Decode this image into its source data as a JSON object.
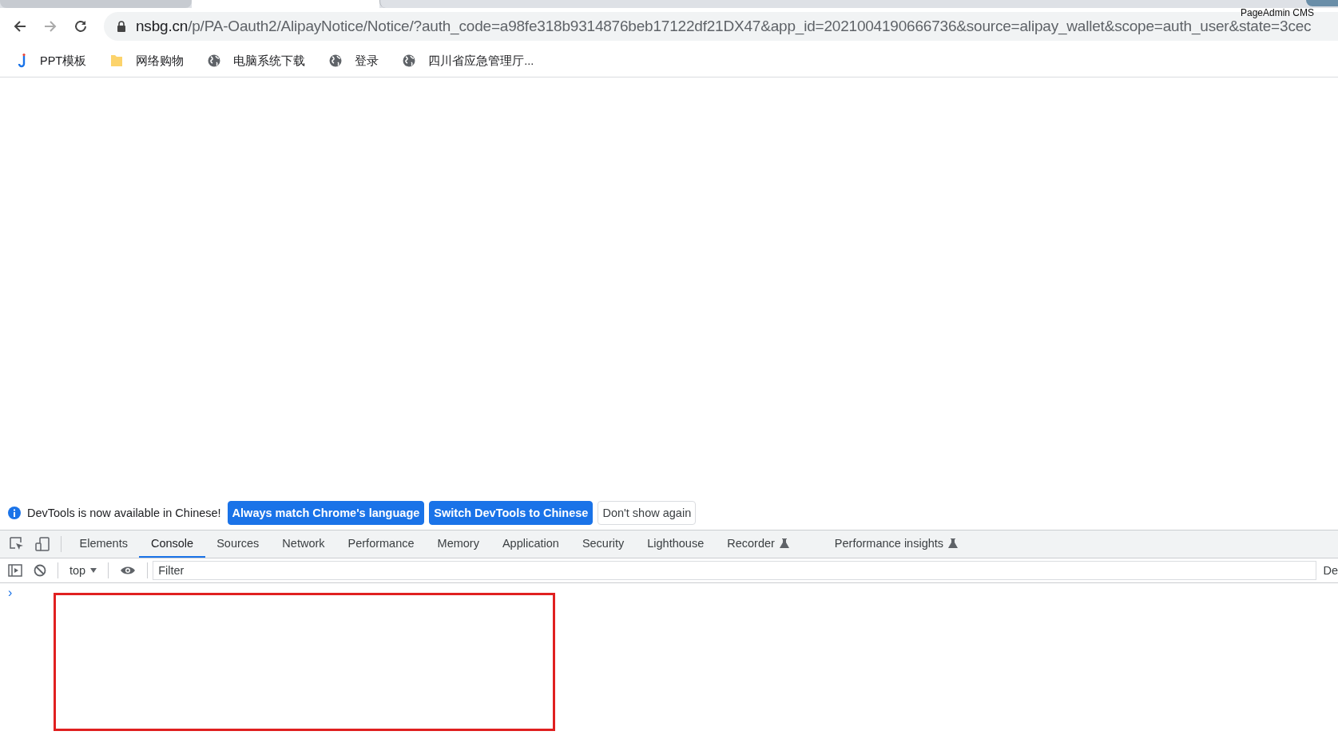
{
  "browser": {
    "tab_tooltip": "PageAdmin CMS",
    "url_host": "nsbg.cn",
    "url_path": "/p/PA-Oauth2/AlipayNotice/Notice/?auth_code=a98fe318b9314876beb17122df21DX47&app_id=2021004190666736&source=alipay_wallet&scope=auth_user&state=3cec",
    "bookmarks": [
      {
        "kind": "app",
        "label": "PPT模板"
      },
      {
        "kind": "folder",
        "label": "网络购物"
      },
      {
        "kind": "globe",
        "label": "电脑系统下载"
      },
      {
        "kind": "globe",
        "label": "登录"
      },
      {
        "kind": "globe",
        "label": "四川省应急管理厅..."
      }
    ]
  },
  "devtools": {
    "infobar": {
      "message": "DevTools is now available in Chinese!",
      "buttons": [
        {
          "kind": "primary",
          "label": "Always match Chrome's language"
        },
        {
          "kind": "primary",
          "label": "Switch DevTools to Chinese"
        },
        {
          "kind": "secondary",
          "label": "Don't show again"
        }
      ]
    },
    "tabs": [
      {
        "label": "Elements",
        "selected": false,
        "experimental": false
      },
      {
        "label": "Console",
        "selected": true,
        "experimental": false
      },
      {
        "label": "Sources",
        "selected": false,
        "experimental": false
      },
      {
        "label": "Network",
        "selected": false,
        "experimental": false
      },
      {
        "label": "Performance",
        "selected": false,
        "experimental": false
      },
      {
        "label": "Memory",
        "selected": false,
        "experimental": false
      },
      {
        "label": "Application",
        "selected": false,
        "experimental": false
      },
      {
        "label": "Security",
        "selected": false,
        "experimental": false
      },
      {
        "label": "Lighthouse",
        "selected": false,
        "experimental": false
      },
      {
        "label": "Recorder",
        "selected": false,
        "experimental": true
      },
      {
        "label": "Performance insights",
        "selected": false,
        "experimental": true
      }
    ],
    "console_toolbar": {
      "context": "top",
      "filter_placeholder": "Filter",
      "levels_label": "De"
    },
    "prompt": "›"
  }
}
